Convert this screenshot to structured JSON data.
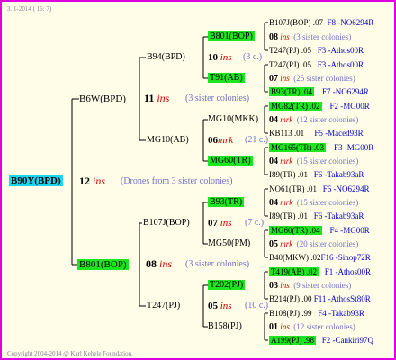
{
  "header": {
    "date": "3. 1-2014 ( 16: 7)"
  },
  "footer": {
    "copyright": "Copyright 2004-2014 @ Karl Kehele Foundation."
  },
  "root": {
    "id": "B90Y(BPD)",
    "inbreeding": "12",
    "ins": "ins",
    "note": "(Drones from 3 sister colonies)"
  },
  "gen1": {
    "father": {
      "id": "B6W(BPD)",
      "inbreeding": "11",
      "ins": "ins",
      "note": "(3 sister colonies)"
    },
    "mother": {
      "id": "B801(BOP)",
      "inbreeding": "08",
      "ins": "ins",
      "note": "(3 sister colonies)"
    }
  },
  "gen2": {
    "ff": {
      "id": "B94(BPD)"
    },
    "fm": {
      "id": "MG10(AB)",
      "inbreeding": "06",
      "ins": "mrk",
      "note": "(21 c.)"
    },
    "mf": {
      "id": "B107J(BOP)",
      "inbreeding": "07",
      "ins": "ins",
      "note": "(7 c.)"
    },
    "mm": {
      "id": "T247(PJ)",
      "inbreeding": "05",
      "ins": "ins",
      "note": "(10 c.)"
    }
  },
  "gen3": {
    "b801": {
      "id": "B801(BOP)",
      "inbreeding": "10",
      "ins": "ins",
      "note": "(3 c.)"
    },
    "t91": {
      "id": "T91(AB)"
    },
    "mg10mkk": {
      "id": "MG10(MKK)"
    },
    "mg60": {
      "id": "MG60(TR)"
    },
    "b93": {
      "id": "B93(TR)"
    },
    "mg50": {
      "id": "MG50(PM)"
    },
    "t202": {
      "id": "T202(PJ)"
    },
    "b158": {
      "id": "B158(PJ)"
    }
  },
  "gen4": {
    "r1": {
      "id": "B107J(BOP)",
      "year": ".07",
      "breeder": "F8 -NO6294R"
    },
    "r2": {
      "inbreeding": "08",
      "ins": "ins",
      "note": "(3 sister colonies)"
    },
    "r3": {
      "id": "T247(PJ)",
      "year": ".05",
      "breeder": "F3 -Athos00R"
    },
    "r4": {
      "id": "T247(PJ)",
      "year": ".05",
      "breeder": "F3 -Athos00R"
    },
    "r5": {
      "inbreeding": "07",
      "ins": "ins",
      "note": "(25 sister colonies)"
    },
    "r6": {
      "id": "B93(TR)",
      "year": ".04",
      "breeder": "F7 -NO6294R"
    },
    "r7": {
      "id": "MG82(TR)",
      "year": ".02",
      "breeder": "F2 -MG00R"
    },
    "r8": {
      "inbreeding": "04",
      "ins": "mrk",
      "note": "(12 sister colonies)"
    },
    "r9": {
      "id": "KB113",
      "year": ".01",
      "breeder": "F5 -Maced93R"
    },
    "r10": {
      "id": "MG165(TR)",
      "year": ".03",
      "breeder": "F3 -MG00R"
    },
    "r11": {
      "inbreeding": "04",
      "ins": "mrk",
      "note": "(15 sister colonies)"
    },
    "r12": {
      "id": "I89(TR)",
      "year": ".01",
      "breeder": "F6 -Takab93aR"
    },
    "r13": {
      "id": "NO61(TR)",
      "year": ".01",
      "breeder": "F6 -NO6294R"
    },
    "r14": {
      "inbreeding": "04",
      "ins": "mrk",
      "note": "(15 sister colonies)"
    },
    "r15": {
      "id": "I89(TR)",
      "year": ".01",
      "breeder": "F6 -Takab93aR"
    },
    "r16": {
      "id": "MG60(TR)",
      "year": ".04",
      "breeder": "F4 -MG00R"
    },
    "r17": {
      "inbreeding": "05",
      "ins": "mrk",
      "note": "(20 sister colonies)"
    },
    "r18": {
      "id": "B40(MKW)",
      "year": ".02",
      "breeder": "F16 -Sinop72R"
    },
    "r19": {
      "id": "T419(AB)",
      "year": ".02",
      "breeder": "F1 -Athos00R"
    },
    "r20": {
      "inbreeding": "03",
      "ins": "ins",
      "note": "(9 sister colonies)"
    },
    "r21": {
      "id": "B214(PJ)",
      "year": ".00",
      "breeder": "F11 -AthosSt80R"
    },
    "r22": {
      "id": "B108(PJ)",
      "year": ".99",
      "breeder": "F4 -Takab93R"
    },
    "r23": {
      "inbreeding": "01",
      "ins": "ins",
      "note": "(12 sister colonies)"
    },
    "r24": {
      "id": "A199(PJ)",
      "year": ".98",
      "breeder": "F2 -Cankiri97Q"
    }
  }
}
